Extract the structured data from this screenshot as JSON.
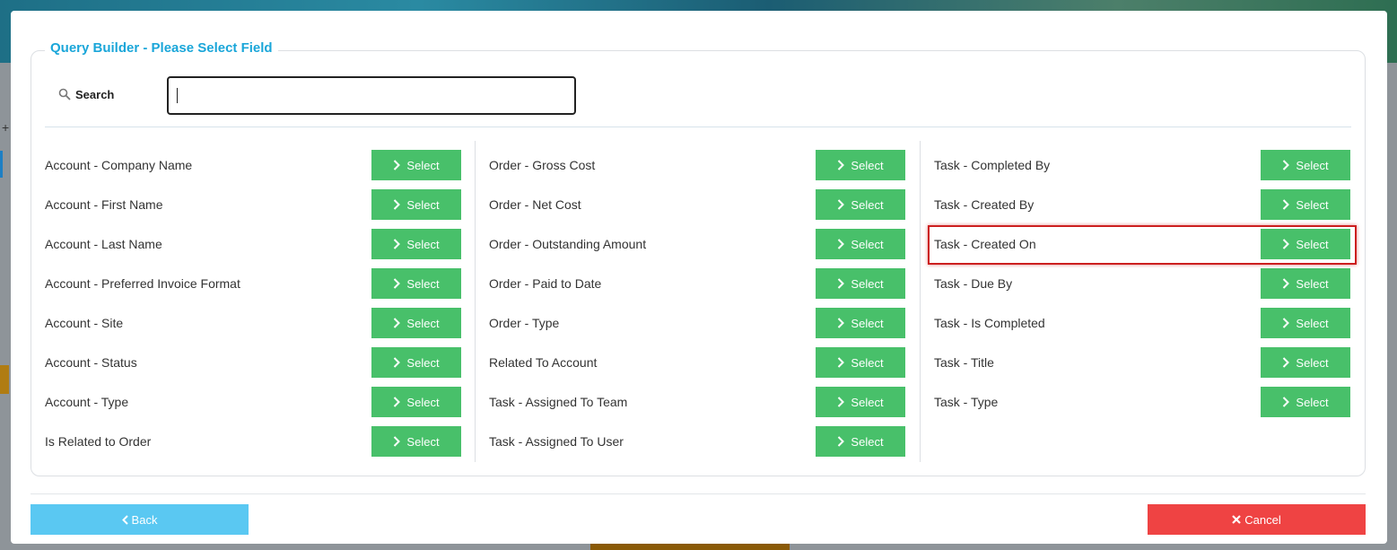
{
  "dialog": {
    "title": "Query Builder - Please Select Field",
    "search_label": "Search",
    "search_value": "",
    "select_label": "Select"
  },
  "columns": [
    {
      "items": [
        {
          "label": "Account - Company Name"
        },
        {
          "label": "Account - First Name"
        },
        {
          "label": "Account - Last Name"
        },
        {
          "label": "Account - Preferred Invoice Format"
        },
        {
          "label": "Account - Site"
        },
        {
          "label": "Account - Status"
        },
        {
          "label": "Account - Type"
        },
        {
          "label": "Is Related to Order"
        }
      ]
    },
    {
      "items": [
        {
          "label": "Order - Gross Cost"
        },
        {
          "label": "Order - Net Cost"
        },
        {
          "label": "Order - Outstanding Amount"
        },
        {
          "label": "Order - Paid to Date"
        },
        {
          "label": "Order - Type"
        },
        {
          "label": "Related To Account"
        },
        {
          "label": "Task - Assigned To Team"
        },
        {
          "label": "Task - Assigned To User"
        }
      ]
    },
    {
      "items": [
        {
          "label": "Task - Completed By"
        },
        {
          "label": "Task - Created By"
        },
        {
          "label": "Task - Created On"
        },
        {
          "label": "Task - Due By"
        },
        {
          "label": "Task - Is Completed"
        },
        {
          "label": "Task - Title"
        },
        {
          "label": "Task - Type"
        }
      ]
    }
  ],
  "highlighted_item": "Task - Created On",
  "footer": {
    "back_label": "Back",
    "cancel_label": "Cancel"
  },
  "colors": {
    "select_button": "#48c06a",
    "back_button": "#5ac8f2",
    "cancel_button": "#ef4343",
    "title": "#1aa6d9",
    "highlight": "#cc1f1f"
  }
}
